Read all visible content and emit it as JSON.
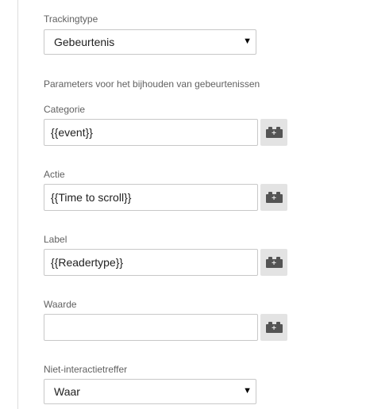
{
  "tracking_type": {
    "label": "Trackingtype",
    "selected": "Gebeurtenis"
  },
  "event_params": {
    "section_label": "Parameters voor het bijhouden van gebeurtenissen",
    "category": {
      "label": "Categorie",
      "value": "{{event}}"
    },
    "action": {
      "label": "Actie",
      "value": "{{Time to scroll}}"
    },
    "event_label": {
      "label": "Label",
      "value": "{{Readertype}}"
    },
    "event_value": {
      "label": "Waarde",
      "value": ""
    }
  },
  "non_interaction": {
    "label": "Niet-interactietreffer",
    "selected": "Waar"
  },
  "icons": {
    "caret": "▼",
    "variable_button": "variable-brick-icon"
  }
}
